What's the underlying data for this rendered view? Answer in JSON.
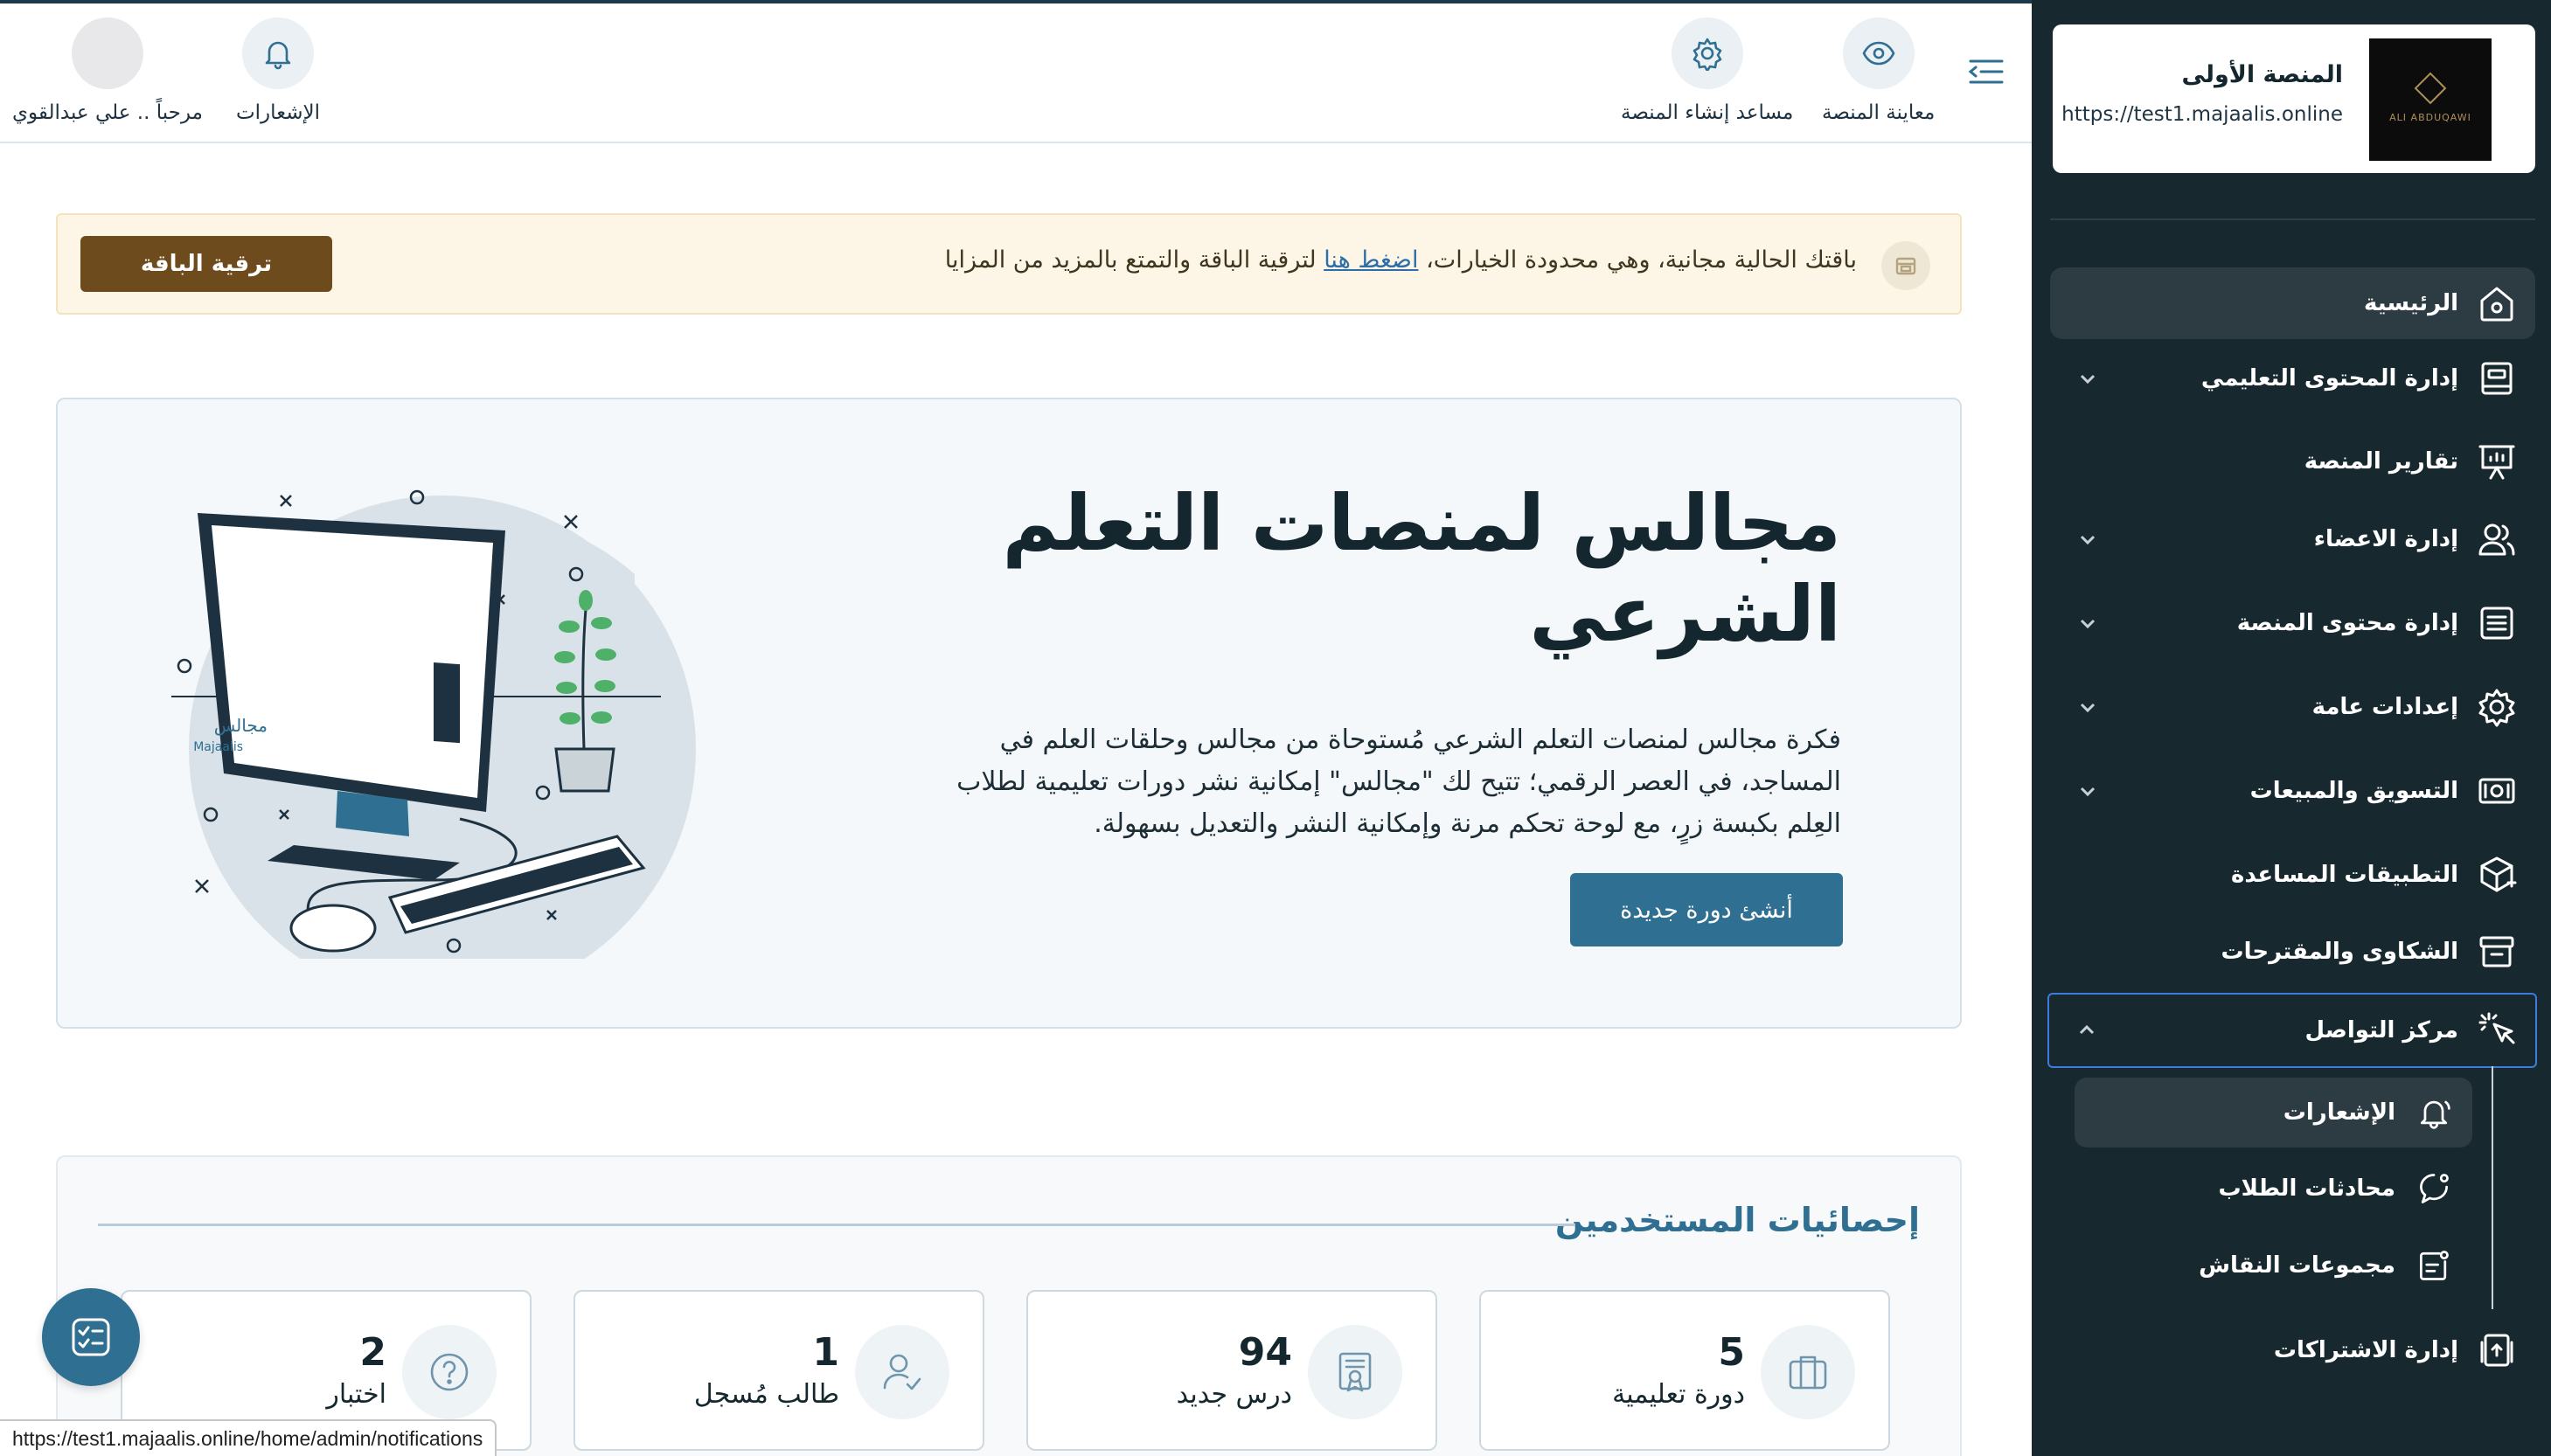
{
  "brand": {
    "name": "المنصة الأولى",
    "url": "https://test1.majaalis.online",
    "logo_text": "ALI ABDUQAWI"
  },
  "sidebar": {
    "items": [
      {
        "label": "الرئيسية",
        "icon": "home-icon",
        "active": true
      },
      {
        "label": "إدارة المحتوى التعليمي",
        "icon": "book-icon",
        "chevron": "down"
      },
      {
        "label": "تقارير المنصة",
        "icon": "presentation-chart-icon"
      },
      {
        "label": "إدارة الاعضاء",
        "icon": "users-icon",
        "chevron": "down"
      },
      {
        "label": "إدارة محتوى المنصة",
        "icon": "list-icon",
        "chevron": "down"
      },
      {
        "label": "إعدادات عامة",
        "icon": "gear-icon",
        "chevron": "down"
      },
      {
        "label": "التسويق والمبيعات",
        "icon": "money-icon",
        "chevron": "down"
      },
      {
        "label": "التطبيقات المساعدة",
        "icon": "box-plus-icon"
      },
      {
        "label": "الشكاوى والمقترحات",
        "icon": "archive-icon"
      },
      {
        "label": "مركز التواصل",
        "icon": "cursor-click-icon",
        "chevron": "up",
        "expanded": true
      },
      {
        "label": "إدارة الاشتراكات",
        "icon": "subscription-icon"
      }
    ],
    "subitems": [
      {
        "label": "الإشعارات",
        "icon": "bell-icon",
        "active": true
      },
      {
        "label": "محادثات الطلاب",
        "icon": "chat-icon"
      },
      {
        "label": "مجموعات النقاش",
        "icon": "discussion-icon"
      }
    ]
  },
  "header": {
    "preview_label": "معاينة المنصة",
    "wizard_label": "مساعد إنشاء المنصة",
    "notifications_label": "الإشعارات",
    "welcome_label": "مرحباً .. علي عبدالقوي"
  },
  "banner": {
    "text_before": "باقتك الحالية مجانية، وهي محدودة الخيارات، ",
    "link_text": "اضغط هنا",
    "text_after": " لترقية الباقة والتمتع بالمزيد من المزايا",
    "button_label": "ترقية الباقة",
    "accent": "#6e4b1c"
  },
  "hero": {
    "title": "مجالس لمنصات التعلم الشرعي",
    "description": "فكرة مجالس لمنصات التعلم الشرعي مُستوحاة من مجالس وحلقات العلم في المساجد، في العصر الرقمي؛ تتيح لك \"مجالس\" إمكانية نشر دورات تعليمية لطلاب العِلم بكبسة زرٍ، مع لوحة تحكم مرنة وإمكانية النشر والتعديل بسهولة.",
    "button_label": "أنشئ دورة جديدة",
    "screen_brand_ar": "مجالس",
    "screen_brand_en": "Majaalis"
  },
  "stats": {
    "title": "إحصائيات المستخدمين",
    "cards": [
      {
        "value": "5",
        "label": "دورة تعليمية",
        "icon": "briefcase-icon"
      },
      {
        "value": "94",
        "label": "درس جديد",
        "icon": "certificate-icon"
      },
      {
        "value": "1",
        "label": "طالب مُسجل",
        "icon": "user-check-icon"
      },
      {
        "value": "2",
        "label": "اختبار",
        "icon": "question-icon"
      }
    ]
  },
  "statusbar": {
    "url": "https://test1.majaalis.online/home/admin/notifications"
  },
  "colors": {
    "sidebar_bg": "#17282f",
    "primary": "#2f6f91",
    "banner_bg": "#fdf6e7"
  }
}
